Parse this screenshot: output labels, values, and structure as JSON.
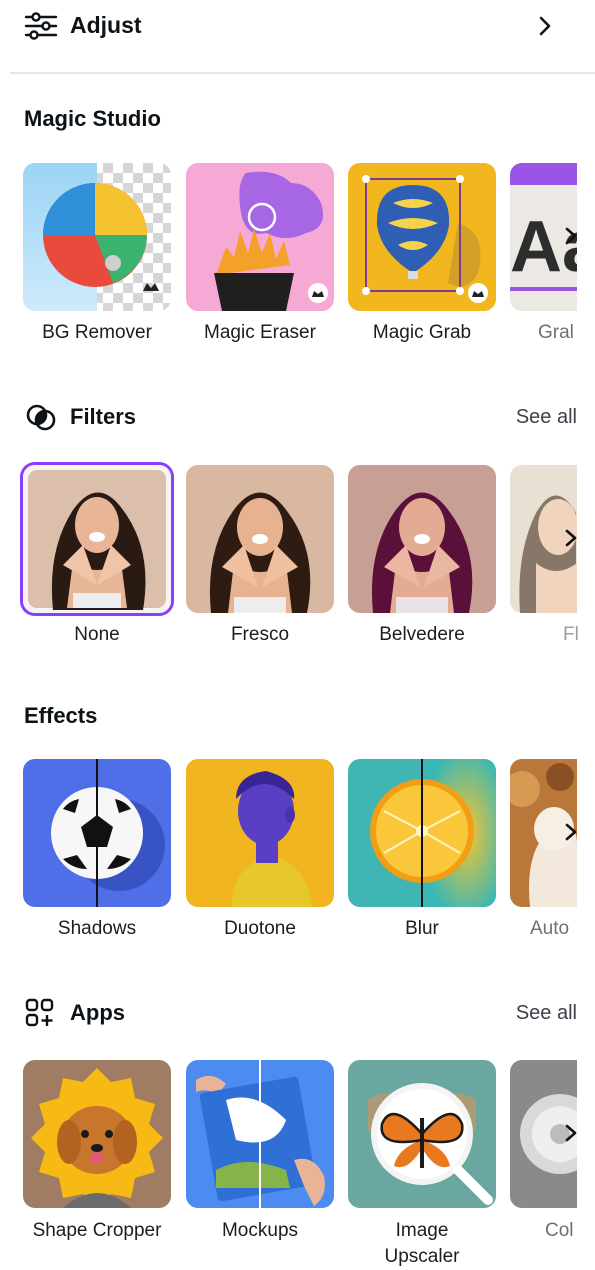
{
  "adjust": {
    "label": "Adjust"
  },
  "magic_studio": {
    "title": "Magic Studio",
    "items": [
      {
        "label": "BG Remover"
      },
      {
        "label": "Magic Eraser"
      },
      {
        "label": "Magic Grab"
      },
      {
        "label": "Gral"
      }
    ]
  },
  "filters": {
    "title": "Filters",
    "see_all": "See all",
    "items": [
      {
        "label": "None"
      },
      {
        "label": "Fresco"
      },
      {
        "label": "Belvedere"
      },
      {
        "label": "Fl"
      }
    ]
  },
  "effects": {
    "title": "Effects",
    "items": [
      {
        "label": "Shadows"
      },
      {
        "label": "Duotone"
      },
      {
        "label": "Blur"
      },
      {
        "label": "Auto"
      }
    ]
  },
  "apps": {
    "title": "Apps",
    "see_all": "See all",
    "items": [
      {
        "label": "Shape Cropper"
      },
      {
        "label": "Mockups"
      },
      {
        "label": "Image Upscaler"
      },
      {
        "label": "Col"
      }
    ]
  },
  "colors": {
    "accent": "#8b3dff",
    "text": "#0d1216",
    "muted": "#3c4149",
    "divider": "#e3e5e8"
  },
  "icons": {
    "adjust": "sliders-icon",
    "filters": "overlapping-circles-icon",
    "apps": "apps-grid-plus-icon",
    "chevron": "chevron-right-icon",
    "premium": "crown-icon"
  }
}
